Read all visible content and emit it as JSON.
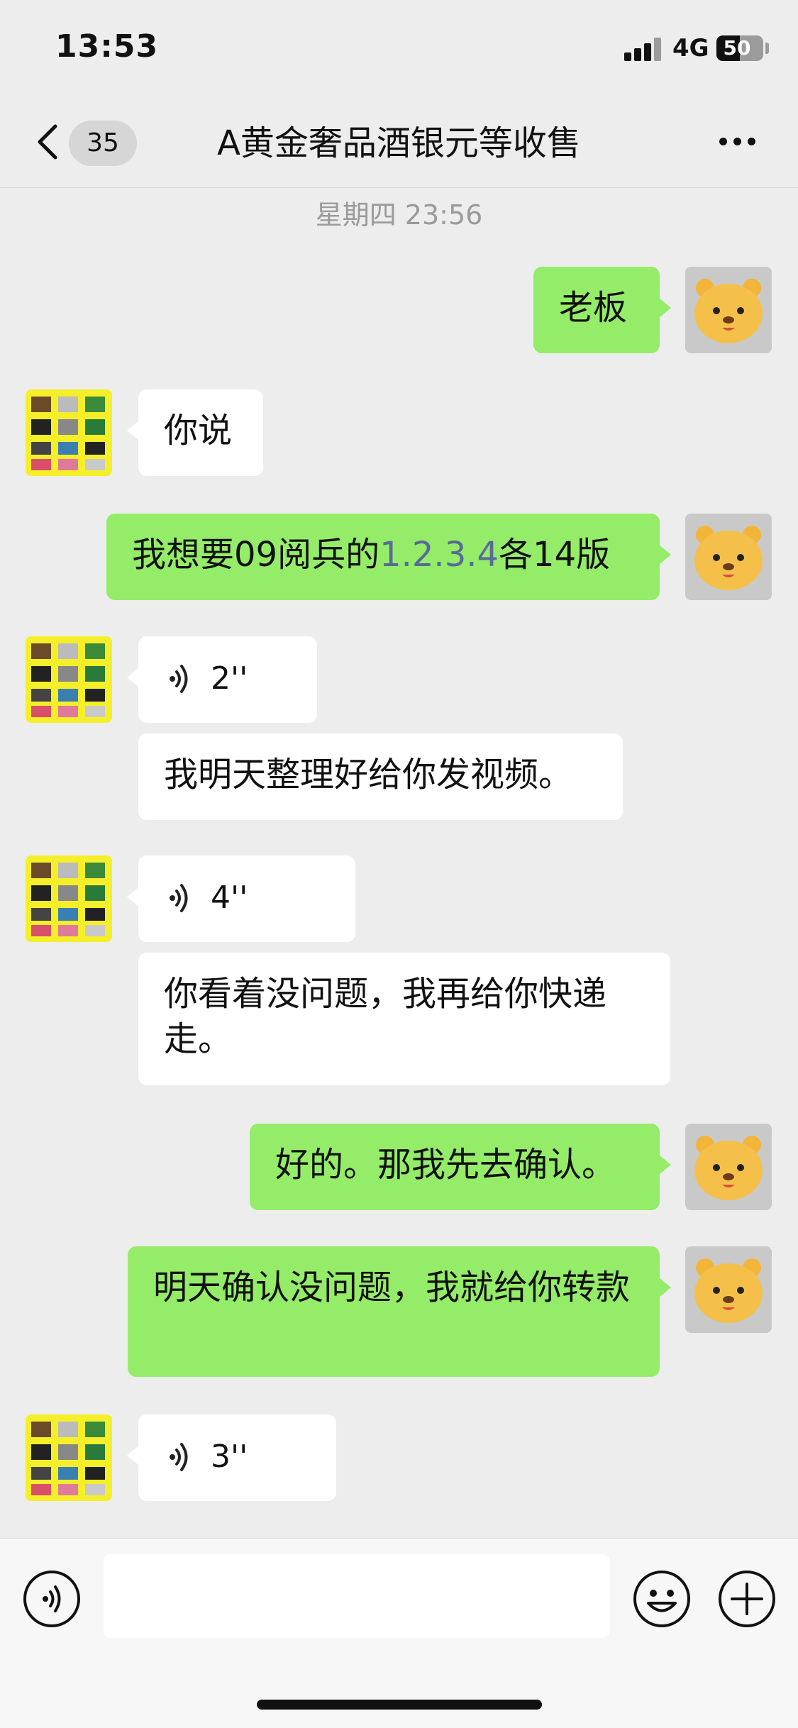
{
  "status_bar": {
    "time": "13:53",
    "network": "4G",
    "battery": "50",
    "battery_level": 0.5
  },
  "nav": {
    "unread_count": "35",
    "title": "A黄金奢品酒银元等收售"
  },
  "timestamp": "星期四 23:56",
  "messages": [
    {
      "sender": "me",
      "text": "老板"
    },
    {
      "sender": "other",
      "text": "你说"
    },
    {
      "sender": "me",
      "text_before": "我想要09阅兵的",
      "link_text": "1.2.3.4",
      "text_after": "各14版"
    },
    {
      "sender": "other",
      "type": "voice",
      "duration": "2''"
    },
    {
      "sender": "other",
      "text": "我明天整理好给你发视频。"
    },
    {
      "sender": "other",
      "type": "voice",
      "duration": "4''"
    },
    {
      "sender": "other",
      "text": "你看着没问题，我再给你快递走。"
    },
    {
      "sender": "me",
      "text": "好的。那我先去确认。"
    },
    {
      "sender": "me",
      "text": "明天确认没问题，我就给你转款"
    },
    {
      "sender": "other",
      "type": "voice",
      "duration": "3''"
    }
  ],
  "icons": {
    "back": "chevron-left-icon",
    "more": "more-icon",
    "voice": "voice-icon",
    "emoji": "emoji-icon",
    "plus": "plus-icon"
  },
  "colors": {
    "my_bubble": "#95ec69",
    "other_bubble": "#ffffff",
    "background": "#ededed",
    "link": "#576b95"
  },
  "input": {
    "value": "",
    "placeholder": ""
  }
}
